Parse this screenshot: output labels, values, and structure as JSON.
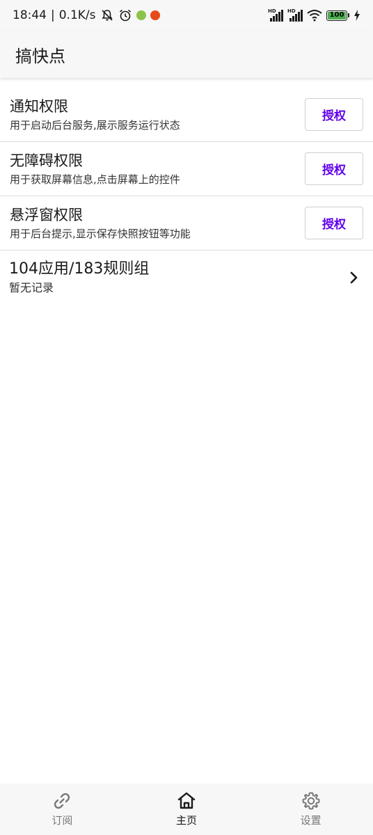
{
  "status_bar": {
    "time": "18:44",
    "separator": "|",
    "speed": "0.1K/s",
    "battery_level": "100",
    "icons": [
      "mute-icon",
      "alarm-icon",
      "app-notification-icon",
      "app-notification-icon",
      "signal-icon",
      "signal-icon",
      "wifi-icon",
      "battery-icon",
      "charging-icon"
    ]
  },
  "app_bar": {
    "title": "搞快点"
  },
  "permissions": [
    {
      "title": "通知权限",
      "description": "用于启动后台服务,展示服务运行状态",
      "button_label": "授权"
    },
    {
      "title": "无障碍权限",
      "description": "用于获取屏幕信息,点击屏幕上的控件",
      "button_label": "授权"
    },
    {
      "title": "悬浮窗权限",
      "description": "用于后台提示,显示保存快照按钮等功能",
      "button_label": "授权"
    }
  ],
  "rules": {
    "title": "104应用/183规则组",
    "subtitle": "暂无记录",
    "icon": "chevron-right-icon"
  },
  "bottom_nav": {
    "items": [
      {
        "label": "订阅",
        "icon": "link-icon",
        "active": false
      },
      {
        "label": "主页",
        "icon": "home-icon",
        "active": true
      },
      {
        "label": "设置",
        "icon": "gear-icon",
        "active": false
      }
    ]
  },
  "colors": {
    "accent": "#6200ee",
    "bar_background": "#f7f7f7",
    "divider": "#dcdcdc"
  }
}
